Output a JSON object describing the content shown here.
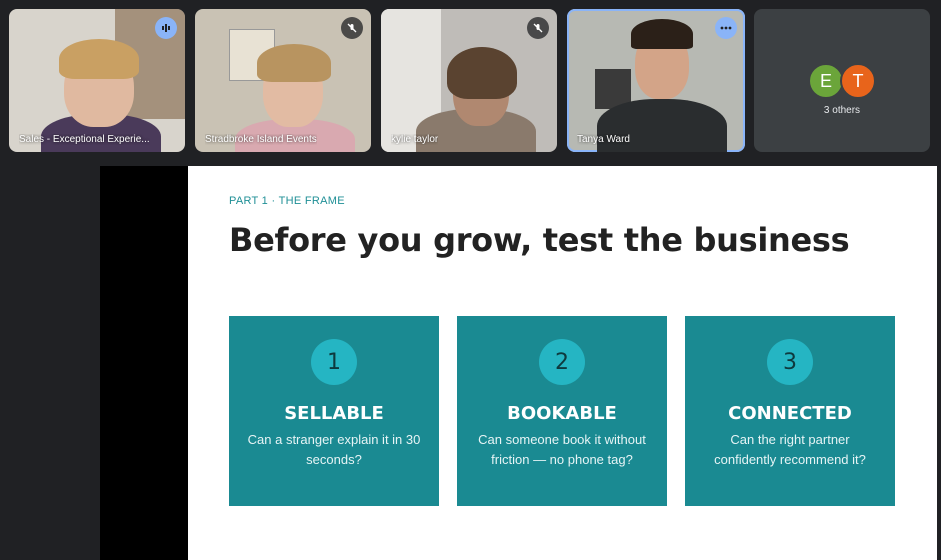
{
  "participants": [
    {
      "name": "Sales - Exceptional Experie...",
      "status_icon": "speaking-icon",
      "bg": "#d8d4cc",
      "shirt": "#4a3a5a"
    },
    {
      "name": "Stradbroke Island Events",
      "status_icon": "mic-off-icon",
      "bg": "#c9c2b4",
      "shirt": "#d9a9b0"
    },
    {
      "name": "kylie taylor",
      "status_icon": "mic-off-icon",
      "bg": "#bfbcb8",
      "shirt": "#8a7a6c"
    },
    {
      "name": "Tanya Ward",
      "status_icon": "more-options-icon",
      "bg": "#b7b9b3",
      "shirt": "#2a2d2f"
    }
  ],
  "others": {
    "label": "3 others",
    "avatars": [
      {
        "letter": "E",
        "color": "#6ba53a"
      },
      {
        "letter": "T",
        "color": "#e8641b"
      }
    ]
  },
  "slide": {
    "eyebrow": "PART 1 · THE FRAME",
    "headline": "Before you grow, test the business",
    "accent": "#1a8a92",
    "cards": [
      {
        "number": "1",
        "title": "SELLABLE",
        "description": "Can a stranger explain it in 30 seconds?"
      },
      {
        "number": "2",
        "title": "BOOKABLE",
        "description": "Can someone book it without friction — no phone tag?"
      },
      {
        "number": "3",
        "title": "CONNECTED",
        "description": "Can the right partner confidently recommend it?"
      }
    ]
  }
}
